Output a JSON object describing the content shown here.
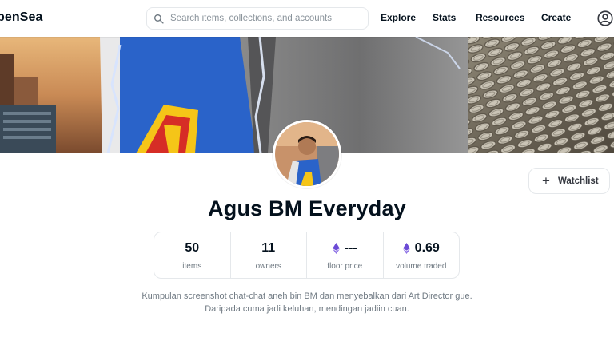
{
  "header": {
    "logo": "penSea",
    "search_placeholder": "Search items, collections, and accounts",
    "nav": [
      "Explore",
      "Stats",
      "Resources",
      "Create"
    ]
  },
  "collection": {
    "name": "Agus BM Everyday",
    "watchlist_label": "Watchlist",
    "stats": [
      {
        "value": "50",
        "label": "items"
      },
      {
        "value": "11",
        "label": "owners"
      },
      {
        "value": "---",
        "label": "floor price"
      },
      {
        "value": "0.69",
        "label": "volume traded"
      }
    ],
    "description_line1": "Kumpulan screenshot chat-chat aneh bin BM dan menyebalkan dari Art Director gue.",
    "description_line2": "Daripada cuma jadi keluhan, mendingan jadiin cuan."
  },
  "colors": {
    "eth_purple": "#6c4bd6",
    "text_dark": "#04111d",
    "text_muted": "#707a83",
    "border": "#e5e8eb"
  },
  "icons": [
    "search-icon",
    "account-icon",
    "plus-icon",
    "ethereum-icon"
  ]
}
